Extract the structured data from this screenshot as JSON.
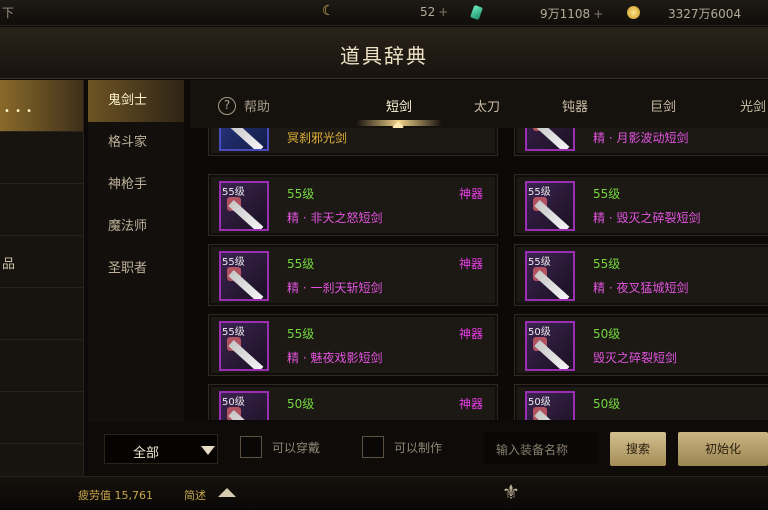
{
  "topbar": {
    "left_fragment": "下",
    "moon_glyph": "☾",
    "fatigue_value": "52",
    "gems": "9万1108",
    "gold": "3327万6004",
    "plus": "+"
  },
  "title": "道具辞典",
  "outer_nav": [
    {
      "label": "",
      "active": true
    },
    {
      "label": "",
      "active": false
    },
    {
      "label": "",
      "active": false
    },
    {
      "label": "品",
      "active": false
    },
    {
      "label": "",
      "active": false
    },
    {
      "label": "",
      "active": false
    },
    {
      "label": "",
      "active": false
    }
  ],
  "classes": [
    {
      "label": "鬼剑士",
      "active": true
    },
    {
      "label": "格斗家",
      "active": false
    },
    {
      "label": "神枪手",
      "active": false
    },
    {
      "label": "魔法师",
      "active": false
    },
    {
      "label": "圣职者",
      "active": false
    }
  ],
  "help_label": "帮助",
  "tabs": [
    {
      "label": "短剑",
      "active": true
    },
    {
      "label": "太刀",
      "active": false
    },
    {
      "label": "钝器",
      "active": false
    },
    {
      "label": "巨剑",
      "active": false
    },
    {
      "label": "光剑",
      "active": false
    }
  ],
  "items": [
    {
      "level": "",
      "rank": "",
      "name": "冥刹邪光剑",
      "tag": "",
      "color": "gold"
    },
    {
      "level": "",
      "rank": "",
      "name": "精 · 月影波动短剑",
      "tag": "",
      "color": "purple"
    },
    {
      "level": "55级",
      "rank": "神器",
      "name": "精 · 非天之怒短剑",
      "tag": "55级",
      "color": "purple"
    },
    {
      "level": "55级",
      "rank": "",
      "name": "精 · 毁灭之碎裂短剑",
      "tag": "55级",
      "color": "purple"
    },
    {
      "level": "55级",
      "rank": "神器",
      "name": "精 · 一刹天斩短剑",
      "tag": "55级",
      "color": "purple"
    },
    {
      "level": "55级",
      "rank": "",
      "name": "精 · 夜叉猛城短剑",
      "tag": "55级",
      "color": "purple"
    },
    {
      "level": "55级",
      "rank": "神器",
      "name": "精 · 魅夜戏影短剑",
      "tag": "55级",
      "color": "purple"
    },
    {
      "level": "50级",
      "rank": "",
      "name": "毁灭之碎裂短剑",
      "tag": "50级",
      "color": "purple"
    },
    {
      "level": "50级",
      "rank": "神器",
      "name": "",
      "tag": "50级",
      "color": "purple"
    },
    {
      "level": "50级",
      "rank": "",
      "name": "",
      "tag": "50级",
      "color": "purple"
    }
  ],
  "filters": {
    "select_value": "全部",
    "wearable_label": "可以穿戴",
    "craftable_label": "可以制作",
    "search_placeholder": "输入装备名称",
    "search_button": "搜索",
    "reset_button": "初始化"
  },
  "bottombar": {
    "fatigue": "疲劳值 15,761",
    "fast": "简述"
  },
  "colors": {
    "level_green": "#73d63d",
    "rank_magenta": "#e83fe8",
    "name_purple": "#e254e0",
    "name_gold": "#e4b43a",
    "accent_gold": "#c8a64a"
  }
}
